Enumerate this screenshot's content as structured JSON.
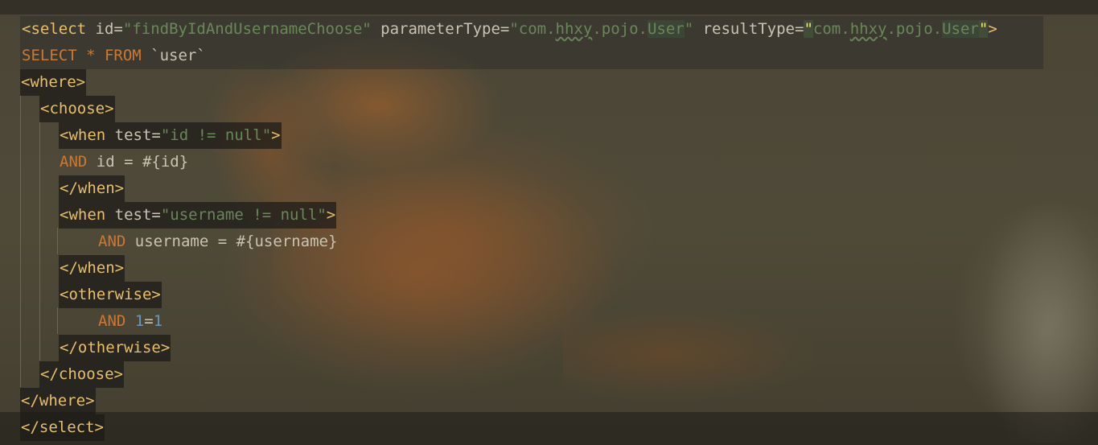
{
  "editor": {
    "lines": [
      {
        "id": 1,
        "tokens": [
          {
            "t": "<",
            "c": "tag"
          },
          {
            "t": "select",
            "c": "tag"
          },
          {
            "t": " id",
            "c": "attr"
          },
          {
            "t": "=",
            "c": "eq"
          },
          {
            "t": "\"findByIdAndUsernameChoose\"",
            "c": "str"
          },
          {
            "t": " parameterType",
            "c": "attr"
          },
          {
            "t": "=",
            "c": "eq"
          },
          {
            "t": "\"com.",
            "c": "str"
          },
          {
            "t": "hhxy",
            "c": "str squig"
          },
          {
            "t": ".pojo.",
            "c": "str"
          },
          {
            "t": "User",
            "c": "str cls-hl"
          },
          {
            "t": "\"",
            "c": "str"
          },
          {
            "t": " resultType",
            "c": "attr"
          },
          {
            "t": "=",
            "c": "eq"
          },
          {
            "t": "\"",
            "c": "q-hl"
          },
          {
            "t": "com.",
            "c": "str"
          },
          {
            "t": "hhxy",
            "c": "str squig"
          },
          {
            "t": ".pojo.",
            "c": "str"
          },
          {
            "t": "User",
            "c": "str cls-hl"
          },
          {
            "t": "\"",
            "c": "q-hl"
          },
          {
            "t": ">",
            "c": "tag"
          }
        ]
      },
      {
        "id": 2,
        "tokens": [
          {
            "t": "SELECT",
            "c": "kw"
          },
          {
            "t": " * ",
            "c": "kw"
          },
          {
            "t": "FROM",
            "c": "kw"
          },
          {
            "t": " `user`",
            "c": "ident"
          }
        ]
      },
      {
        "id": 3,
        "tokens": [
          {
            "t": "<where>",
            "c": "tag"
          }
        ]
      },
      {
        "id": 4,
        "tokens": [
          {
            "t": "<choose>",
            "c": "tag"
          }
        ]
      },
      {
        "id": 5,
        "tokens": [
          {
            "t": "<when",
            "c": "tag"
          },
          {
            "t": " test",
            "c": "attr"
          },
          {
            "t": "=",
            "c": "eq"
          },
          {
            "t": "\"id != null\"",
            "c": "str"
          },
          {
            "t": ">",
            "c": "tag"
          }
        ]
      },
      {
        "id": 6,
        "tokens": [
          {
            "t": "AND",
            "c": "kw"
          },
          {
            "t": " id = #{id}",
            "c": "plain"
          }
        ]
      },
      {
        "id": 7,
        "tokens": [
          {
            "t": "</when>",
            "c": "tag"
          }
        ]
      },
      {
        "id": 8,
        "tokens": [
          {
            "t": "<when",
            "c": "tag"
          },
          {
            "t": " test",
            "c": "attr"
          },
          {
            "t": "=",
            "c": "eq"
          },
          {
            "t": "\"username != null\"",
            "c": "str"
          },
          {
            "t": ">",
            "c": "tag"
          }
        ]
      },
      {
        "id": 9,
        "tokens": [
          {
            "t": "AND",
            "c": "kw"
          },
          {
            "t": " username = #{username}",
            "c": "plain"
          }
        ]
      },
      {
        "id": 10,
        "tokens": [
          {
            "t": "</when>",
            "c": "tag"
          }
        ]
      },
      {
        "id": 11,
        "tokens": [
          {
            "t": "<otherwise>",
            "c": "tag"
          }
        ]
      },
      {
        "id": 12,
        "tokens": [
          {
            "t": "AND",
            "c": "kw"
          },
          {
            "t": " ",
            "c": "plain"
          },
          {
            "t": "1",
            "c": "num"
          },
          {
            "t": "=",
            "c": "plain"
          },
          {
            "t": "1",
            "c": "num"
          }
        ]
      },
      {
        "id": 13,
        "tokens": [
          {
            "t": "</otherwise>",
            "c": "tag"
          }
        ]
      },
      {
        "id": 14,
        "tokens": [
          {
            "t": "</choose>",
            "c": "tag"
          }
        ]
      },
      {
        "id": 15,
        "tokens": [
          {
            "t": "</where>",
            "c": "tag"
          }
        ]
      },
      {
        "id": 16,
        "tokens": [
          {
            "t": "</select>",
            "c": "tag"
          }
        ]
      }
    ]
  }
}
